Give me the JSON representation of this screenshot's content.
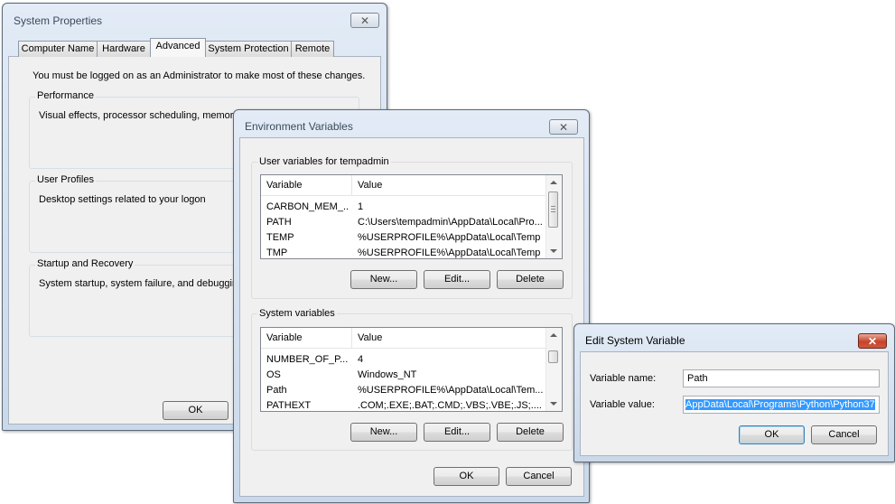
{
  "sysprops": {
    "title": "System Properties",
    "close": "✕",
    "tabs": [
      "Computer Name",
      "Hardware",
      "Advanced",
      "System Protection",
      "Remote"
    ],
    "admin_note": "You must be logged on as an Administrator to make most of these changes.",
    "performance": {
      "label": "Performance",
      "text": "Visual effects, processor scheduling, memory u"
    },
    "user_profiles": {
      "label": "User Profiles",
      "text": "Desktop settings related to your logon"
    },
    "startup": {
      "label": "Startup and Recovery",
      "text": "System startup, system failure, and debugging"
    },
    "ok": "OK"
  },
  "envvars": {
    "title": "Environment Variables",
    "close": "✕",
    "user_section": "User variables for tempadmin",
    "system_section": "System variables",
    "col_variable": "Variable",
    "col_value": "Value",
    "user_rows": [
      {
        "variable": "CARBON_MEM_...",
        "value": "1"
      },
      {
        "variable": "PATH",
        "value": "C:\\Users\\tempadmin\\AppData\\Local\\Pro..."
      },
      {
        "variable": "TEMP",
        "value": "%USERPROFILE%\\AppData\\Local\\Temp"
      },
      {
        "variable": "TMP",
        "value": "%USERPROFILE%\\AppData\\Local\\Temp"
      }
    ],
    "system_rows": [
      {
        "variable": "NUMBER_OF_P...",
        "value": "4"
      },
      {
        "variable": "OS",
        "value": "Windows_NT"
      },
      {
        "variable": "Path",
        "value": "%USERPROFILE%\\AppData\\Local\\Tem..."
      },
      {
        "variable": "PATHEXT",
        "value": ".COM;.EXE;.BAT;.CMD;.VBS;.VBE;.JS;...."
      }
    ],
    "new": "New...",
    "edit": "Edit...",
    "delete": "Delete",
    "ok": "OK",
    "cancel": "Cancel"
  },
  "editvar": {
    "title": "Edit System Variable",
    "close": "✕",
    "name_label": "Variable name:",
    "name_value": "Path",
    "value_label": "Variable value:",
    "value_value": "AppData\\Local\\Programs\\Python\\Python37",
    "ok": "OK",
    "cancel": "Cancel"
  }
}
